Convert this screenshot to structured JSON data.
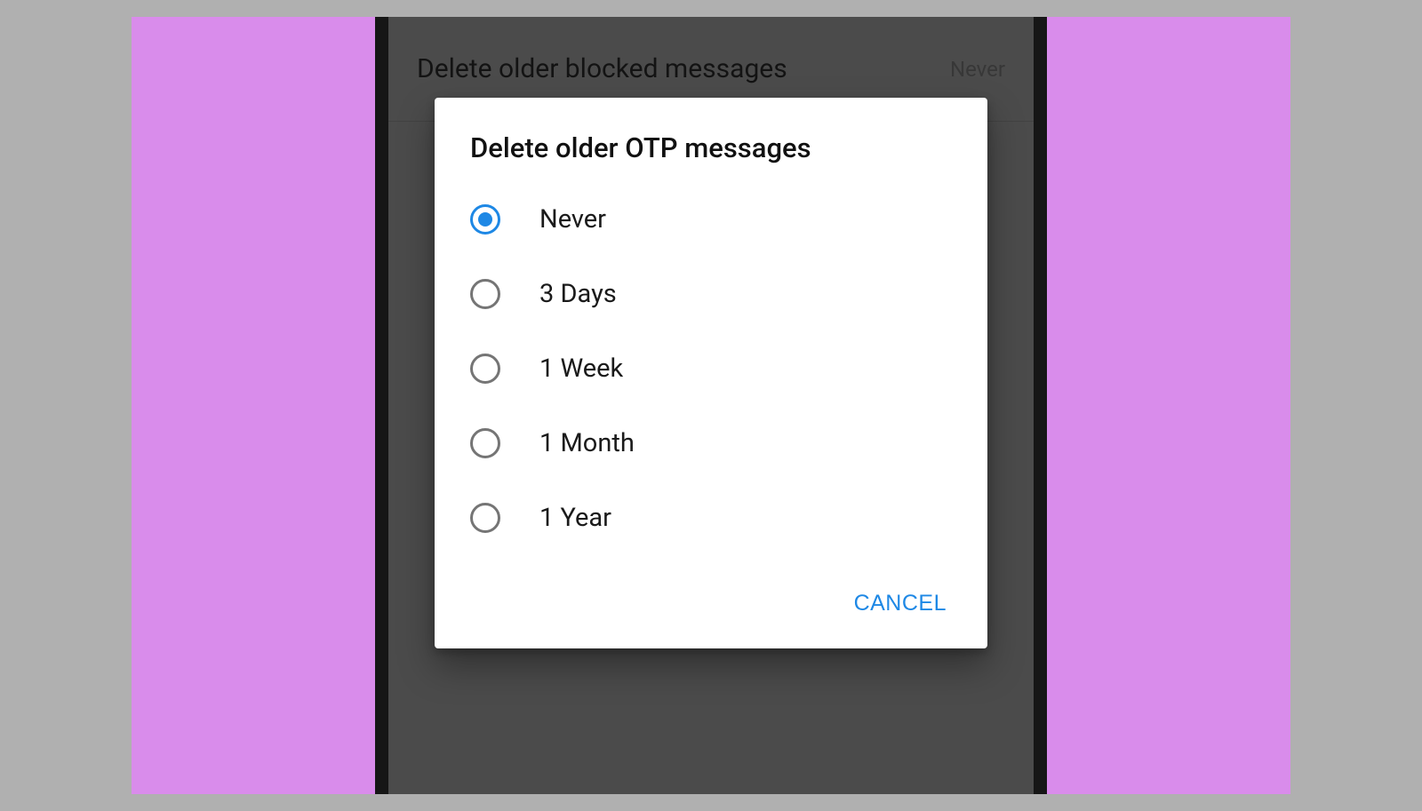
{
  "colors": {
    "accent": "#1e88e5",
    "purple_bg": "#d98ceb"
  },
  "background_setting": {
    "title": "Delete older blocked messages",
    "value": "Never"
  },
  "dialog": {
    "title": "Delete older OTP messages",
    "options": [
      {
        "label": "Never",
        "selected": true
      },
      {
        "label": "3 Days",
        "selected": false
      },
      {
        "label": "1 Week",
        "selected": false
      },
      {
        "label": "1 Month",
        "selected": false
      },
      {
        "label": "1 Year",
        "selected": false
      }
    ],
    "cancel_label": "CANCEL"
  }
}
